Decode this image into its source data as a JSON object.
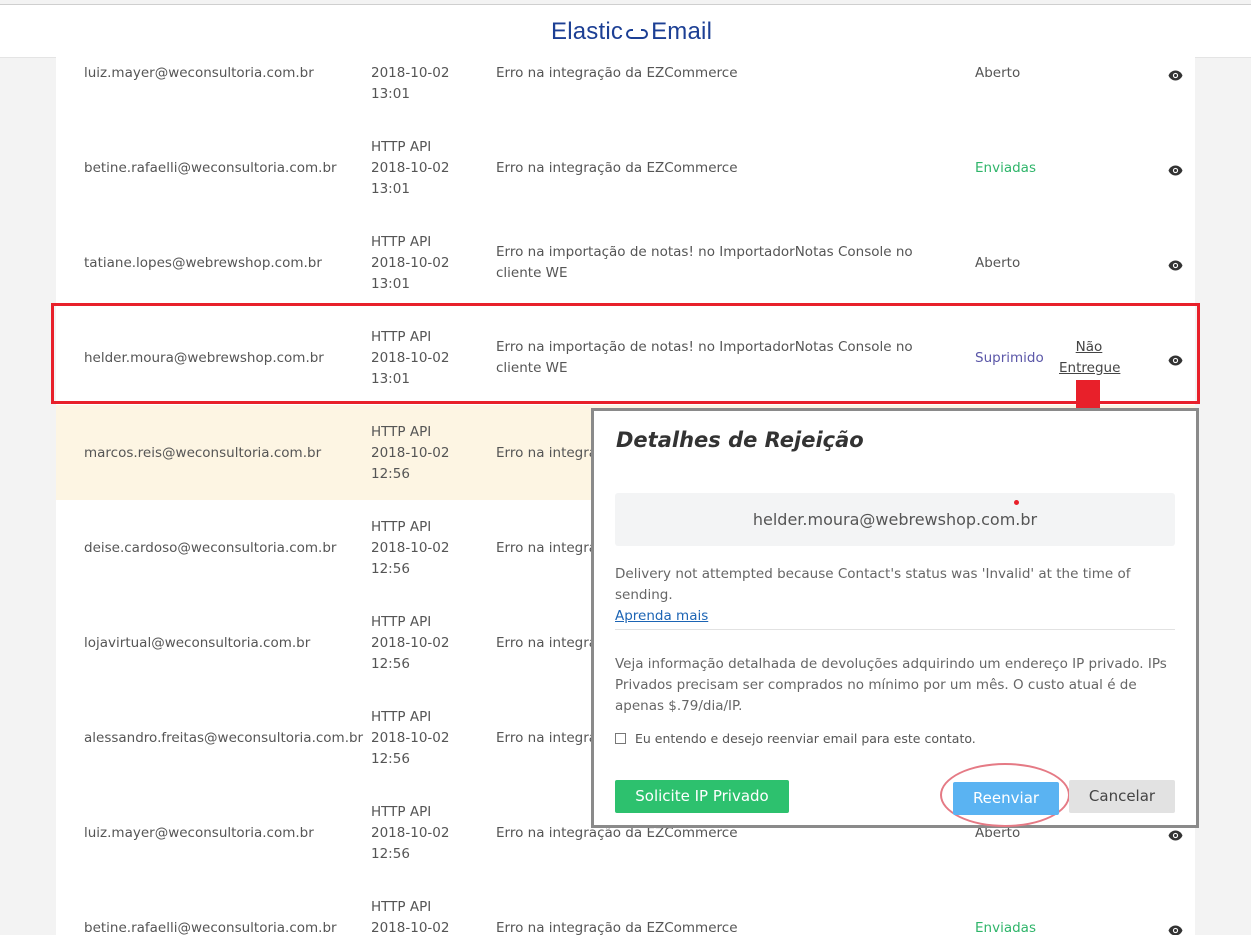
{
  "header": {
    "logo_left": "Elastic",
    "logo_right": "Email"
  },
  "rows": [
    {
      "email": "luiz.mayer@weconsultoria.com.br",
      "source": "",
      "date": "2018-10-02",
      "time": "13:01",
      "subject": "Erro na integração da EZCommerce",
      "status": "Aberto",
      "status_type": "aberto",
      "extra": ""
    },
    {
      "email": "betine.rafaelli@weconsultoria.com.br",
      "source": "HTTP API",
      "date": "2018-10-02",
      "time": "13:01",
      "subject": "Erro na integração da EZCommerce",
      "status": "Enviadas",
      "status_type": "enviadas",
      "extra": ""
    },
    {
      "email": "tatiane.lopes@webrewshop.com.br",
      "source": "HTTP API",
      "date": "2018-10-02",
      "time": "13:01",
      "subject": "Erro na importação de notas! no ImportadorNotas Console no cliente WE",
      "status": "Aberto",
      "status_type": "aberto",
      "extra": ""
    },
    {
      "email": "helder.moura@webrewshop.com.br",
      "source": "HTTP API",
      "date": "2018-10-02",
      "time": "13:01",
      "subject": "Erro na importação de notas! no ImportadorNotas Console no cliente WE",
      "status": "Suprimido",
      "status_type": "suprimido",
      "extra": "Não Entregue"
    },
    {
      "email": "marcos.reis@weconsultoria.com.br",
      "source": "HTTP API",
      "date": "2018-10-02",
      "time": "12:56",
      "subject": "Erro na integra",
      "status": "",
      "status_type": "",
      "extra": ""
    },
    {
      "email": "deise.cardoso@weconsultoria.com.br",
      "source": "HTTP API",
      "date": "2018-10-02",
      "time": "12:56",
      "subject": "Erro na integra",
      "status": "",
      "status_type": "",
      "extra": ""
    },
    {
      "email": "lojavirtual@weconsultoria.com.br",
      "source": "HTTP API",
      "date": "2018-10-02",
      "time": "12:56",
      "subject": "Erro na integra",
      "status": "",
      "status_type": "",
      "extra": ""
    },
    {
      "email": "alessandro.freitas@weconsultoria.com.br",
      "source": "HTTP API",
      "date": "2018-10-02",
      "time": "12:56",
      "subject": "Erro na integra",
      "status": "",
      "status_type": "",
      "extra": ""
    },
    {
      "email": "luiz.mayer@weconsultoria.com.br",
      "source": "HTTP API",
      "date": "2018-10-02",
      "time": "12:56",
      "subject": "Erro na integração da EZCommerce",
      "status": "Aberto",
      "status_type": "aberto",
      "extra": ""
    },
    {
      "email": "betine.rafaelli@weconsultoria.com.br",
      "source": "HTTP API",
      "date": "2018-10-02",
      "time": "",
      "subject": "Erro na integração da EZCommerce",
      "status": "Enviadas",
      "status_type": "enviadas",
      "extra": ""
    }
  ],
  "modal": {
    "title": "Detalhes de Rejeição",
    "email": "helder.moura@webrewshop.com.br",
    "reason": "Delivery not attempted because Contact's status was 'Invalid' at the time of sending.",
    "learn_more": "Aprenda mais",
    "info": "Veja informação detalhada de devoluções adquirindo um endereço IP privado. IPs Privados precisam ser comprados no mínimo por um mês. O custo atual é de apenas $.79/dia/IP.",
    "consent_label": "Eu entendo e desejo reenviar email para este contato.",
    "consent_checked": false,
    "btn_private_ip": "Solicite IP Privado",
    "btn_resend": "Reenviar",
    "btn_cancel": "Cancelar"
  },
  "colors": {
    "brand": "#1c3f94",
    "enviadas": "#2fb56a",
    "suprimido": "#5b57a8",
    "annotation": "#e8202a",
    "primary_green": "#2dc16e",
    "primary_blue": "#5ab3f2"
  },
  "icons": {
    "row_action": "eye-icon",
    "logo_link": "link-icon"
  }
}
